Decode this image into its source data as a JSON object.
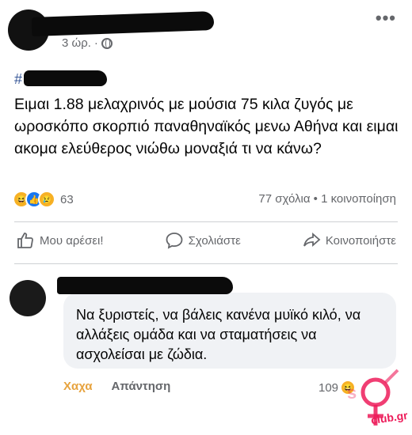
{
  "post": {
    "time": "3 ώρ.",
    "dot": "·",
    "hashtag_prefix": "#",
    "text": "Ειμαι 1.88 μελαχρινός με μούσια 75 κιλα  ζυγός με ωροσκόπο σκορπιό παναθηναϊκός μενω Αθήνα και ειμαι ακομα ελεύθερος νιώθω μοναξιά τι να κάνω?",
    "reaction_count": "63",
    "counts": "77 σχόλια • 1 κοινοποίηση",
    "reactions": [
      "haha",
      "like",
      "sad"
    ]
  },
  "actions": {
    "like": "Μου αρέσει!",
    "comment": "Σχολιάστε",
    "share": "Κοινοποιήστε"
  },
  "comment": {
    "text": "Να ξυριστείς, να βάλεις κανένα μυϊκό κιλό, να αλλάξεις ομάδα και να σταματήσεις να ασχολείσαι με ζώδια.",
    "haha_label": "Χαχα",
    "reply_label": "Απάντηση",
    "reaction_count": "109"
  },
  "colors": {
    "accent": "#1877f2",
    "haha": "#e7a33e",
    "watermark": "#ed1c5a"
  },
  "watermark": {
    "text": "club.gr"
  }
}
